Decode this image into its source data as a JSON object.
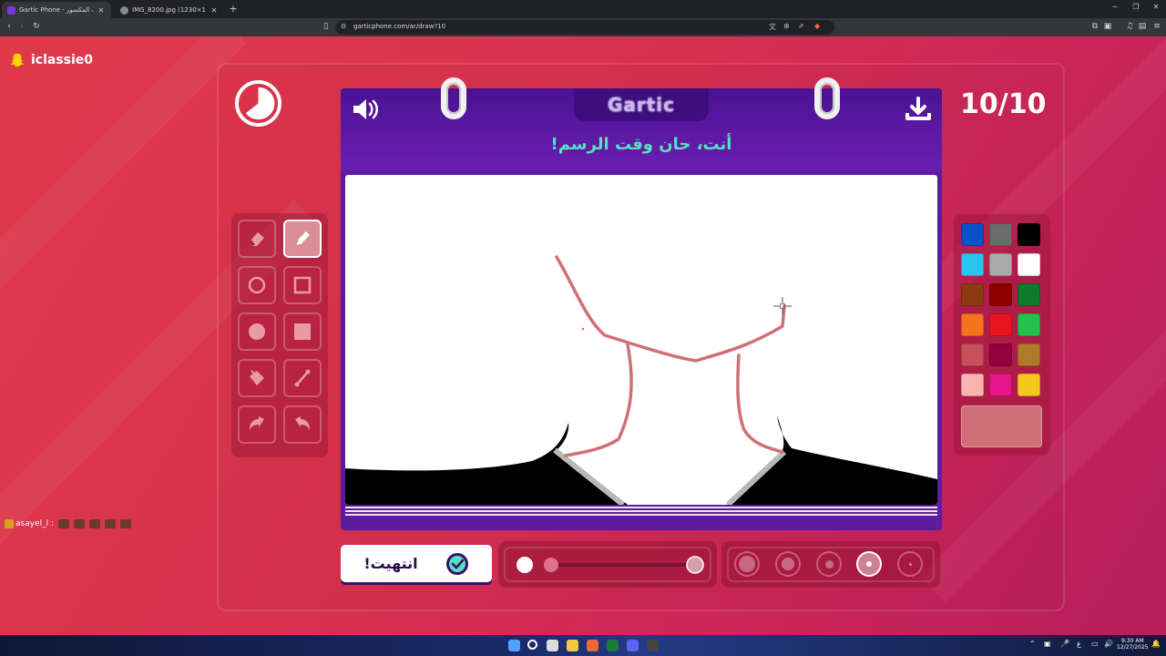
{
  "browser": {
    "tabs": [
      {
        "title": "Gartic Phone - لعبة الهاتف المكسور",
        "active": true
      },
      {
        "title": "IMG_8200.jpg (1230×1167)",
        "active": false
      }
    ],
    "new_tab": "+",
    "url": "garticphone.com/ar/draw?10"
  },
  "game": {
    "username": "iclassie0",
    "round_counter": "10/10",
    "logo": "Gartic",
    "prompt": "أنت، حان وقت الرسم!",
    "done_label": "انتهيت!",
    "chat": {
      "name": "asayel_l :"
    },
    "tools": [
      {
        "name": "eraser-icon"
      },
      {
        "name": "pencil-icon",
        "active": true
      },
      {
        "name": "circle-outline-icon"
      },
      {
        "name": "square-outline-icon"
      },
      {
        "name": "circle-filled-icon"
      },
      {
        "name": "square-filled-icon"
      },
      {
        "name": "bucket-icon"
      },
      {
        "name": "line-icon"
      },
      {
        "name": "undo-icon"
      },
      {
        "name": "redo-icon"
      }
    ],
    "palette": [
      "#0a50c8",
      "#6c6c6c",
      "#000000",
      "#29c4f0",
      "#aaaaaa",
      "#ffffff",
      "#8b3a12",
      "#8c0000",
      "#0f7a2a",
      "#f5721e",
      "#e8141e",
      "#23c24c",
      "#c8505a",
      "#93003c",
      "#b07a2a",
      "#f9b4b0",
      "#e8148c",
      "#f5c61e"
    ],
    "current_color": "#d07076",
    "brush_level": "3 of 5",
    "opacity_level": "4 of 5"
  },
  "taskbar": {
    "time": "9:30 AM",
    "date": "12/27/2025"
  },
  "colors": {
    "accent": "#5e1ba0",
    "prompt": "#57e0c2",
    "background": "#d8344f"
  }
}
